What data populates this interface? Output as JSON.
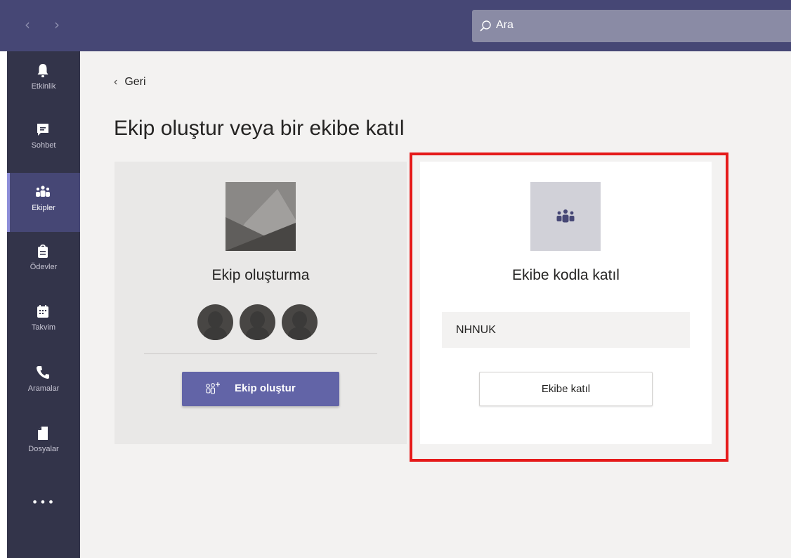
{
  "topbar": {
    "back_icon": "chevron-left-icon",
    "forward_icon": "chevron-right-icon",
    "search": {
      "placeholder": "Ara",
      "icon": "search-icon"
    }
  },
  "rail": {
    "items": [
      {
        "label": "Etkinlik",
        "icon": "bell-icon"
      },
      {
        "label": "Sohbet",
        "icon": "chat-icon"
      },
      {
        "label": "Ekipler",
        "icon": "teams-icon",
        "active": true
      },
      {
        "label": "Ödevler",
        "icon": "assignments-icon"
      },
      {
        "label": "Takvim",
        "icon": "calendar-icon"
      },
      {
        "label": "Aramalar",
        "icon": "phone-icon"
      },
      {
        "label": "Dosyalar",
        "icon": "files-icon"
      }
    ],
    "more_label": "•••"
  },
  "main": {
    "back_label": "Geri",
    "title": "Ekip oluştur veya bir ekibe katıl",
    "create_card": {
      "title": "Ekip oluşturma",
      "button_label": "Ekip oluştur"
    },
    "join_card": {
      "title": "Ekibe kodla katıl",
      "code_value": "NHNUK",
      "button_label": "Ekibe katıl"
    }
  },
  "colors": {
    "topbar": "#464775",
    "rail": "#33344a",
    "accent": "#6264a7",
    "highlight": "#e51a1a"
  }
}
